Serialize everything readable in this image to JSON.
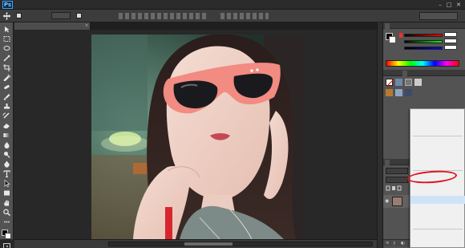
{
  "app": {
    "logo": "Ps"
  },
  "menubar": {
    "items": [
      {
        "label": ""
      },
      {
        "label": ""
      },
      {
        "label": ""
      },
      {
        "label": ""
      },
      {
        "label": ""
      },
      {
        "label": ""
      },
      {
        "label": ""
      },
      {
        "label": ""
      },
      {
        "label": ""
      },
      {
        "label": ""
      },
      {
        "label": ""
      }
    ],
    "window_controls": [
      "–",
      "□",
      "✕"
    ]
  },
  "options_bar": {
    "auto_select_label": "",
    "auto_select_value": "",
    "show_transform_label": "",
    "workspace": ""
  },
  "document": {
    "tab_title": "",
    "zoom": "",
    "status_info": ""
  },
  "right_panel": {
    "color_tabs": [
      "",
      ""
    ],
    "adjust_tabs": [
      "",
      ""
    ],
    "layers_tabs": [
      "",
      "",
      ""
    ],
    "layers_filter": "",
    "layers_blend": "",
    "colors": {
      "slider_r": "#d33",
      "slider_g": "#3a3",
      "slider_b": "#33d"
    }
  },
  "adjustment_menu": {
    "items": [
      {
        "label": ""
      },
      {
        "label": ""
      },
      {
        "label": ""
      },
      {
        "label": ""
      },
      {
        "label": ""
      },
      {
        "label": ""
      },
      {
        "label": ""
      },
      {
        "label": ""
      },
      {
        "label": ""
      },
      {
        "label": ""
      },
      {
        "label": ""
      },
      {
        "label": ""
      },
      {
        "label": ""
      },
      {
        "label": ""
      },
      {
        "label": ""
      },
      {
        "label": ""
      },
      {
        "label": ""
      }
    ],
    "highlighted_index": 10
  },
  "annotation": {
    "color": "#e0141c"
  }
}
